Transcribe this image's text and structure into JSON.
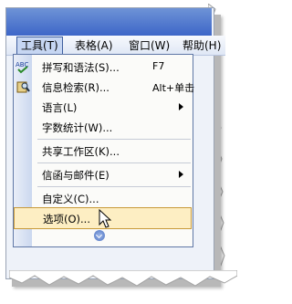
{
  "menubar": {
    "items": [
      {
        "label": "工具(T)"
      },
      {
        "label": "表格(A)"
      },
      {
        "label": "窗口(W)"
      },
      {
        "label": "帮助(H)"
      }
    ]
  },
  "tools_menu": {
    "items": [
      {
        "label": "拼写和语法(S)...",
        "shortcut": "F7",
        "icon": "spelling-abc-check-icon"
      },
      {
        "label": "信息检索(R)...",
        "shortcut": "Alt+单击",
        "icon": "research-book-icon"
      },
      {
        "label": "语言(L)",
        "submenu": true
      },
      {
        "label": "字数统计(W)..."
      },
      {
        "label": "共享工作区(K)..."
      },
      {
        "label": "信函与邮件(E)",
        "submenu": true
      },
      {
        "label": "自定义(C)..."
      },
      {
        "label": "选项(O)...",
        "highlighted": true
      }
    ],
    "expand_icon": "double-chevron-down-icon"
  },
  "colors": {
    "menu_highlight": "#fdeec3",
    "menubar_active": "#c6d6f2",
    "titlebar": "#3d66c8"
  }
}
